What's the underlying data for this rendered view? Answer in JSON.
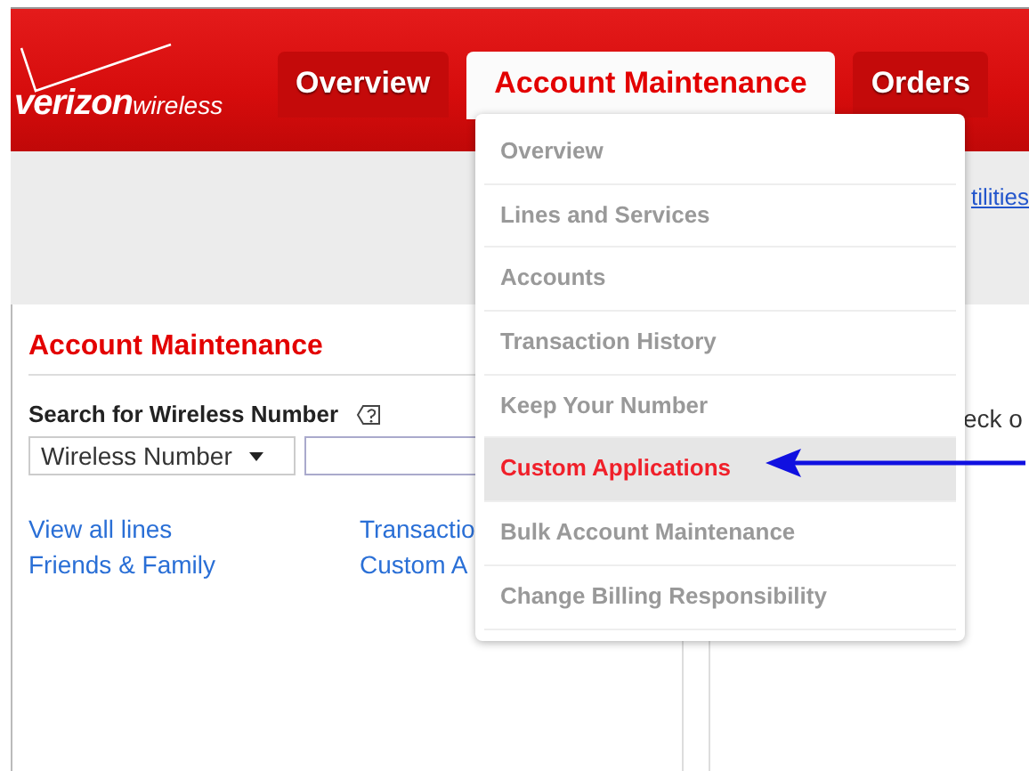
{
  "header": {
    "logo": {
      "brand": "verizon",
      "suffix": "wireless"
    },
    "tabs": [
      {
        "label": "Overview",
        "selected": false
      },
      {
        "label": "Account Maintenance",
        "selected": true
      },
      {
        "label": "Orders",
        "selected": false
      }
    ]
  },
  "utility_link": "tilities",
  "dropdown": {
    "items": [
      {
        "label": "Overview",
        "selected": false
      },
      {
        "label": "Lines and Services",
        "selected": false
      },
      {
        "label": "Accounts",
        "selected": false
      },
      {
        "label": "Transaction History",
        "selected": false
      },
      {
        "label": "Keep Your Number",
        "selected": false
      },
      {
        "label": "Custom Applications",
        "selected": true
      },
      {
        "label": "Bulk Account Maintenance",
        "selected": false
      },
      {
        "label": "Change Billing Responsibility",
        "selected": false
      }
    ]
  },
  "left_panel": {
    "title": "Account Maintenance",
    "search": {
      "label": "Search for Wireless Number",
      "select": "Wireless Number"
    },
    "links": [
      [
        "View all lines",
        "Friends & Family"
      ],
      [
        "Transactio",
        "Custom A"
      ]
    ]
  },
  "right_panel": {
    "text": "eck o"
  }
}
